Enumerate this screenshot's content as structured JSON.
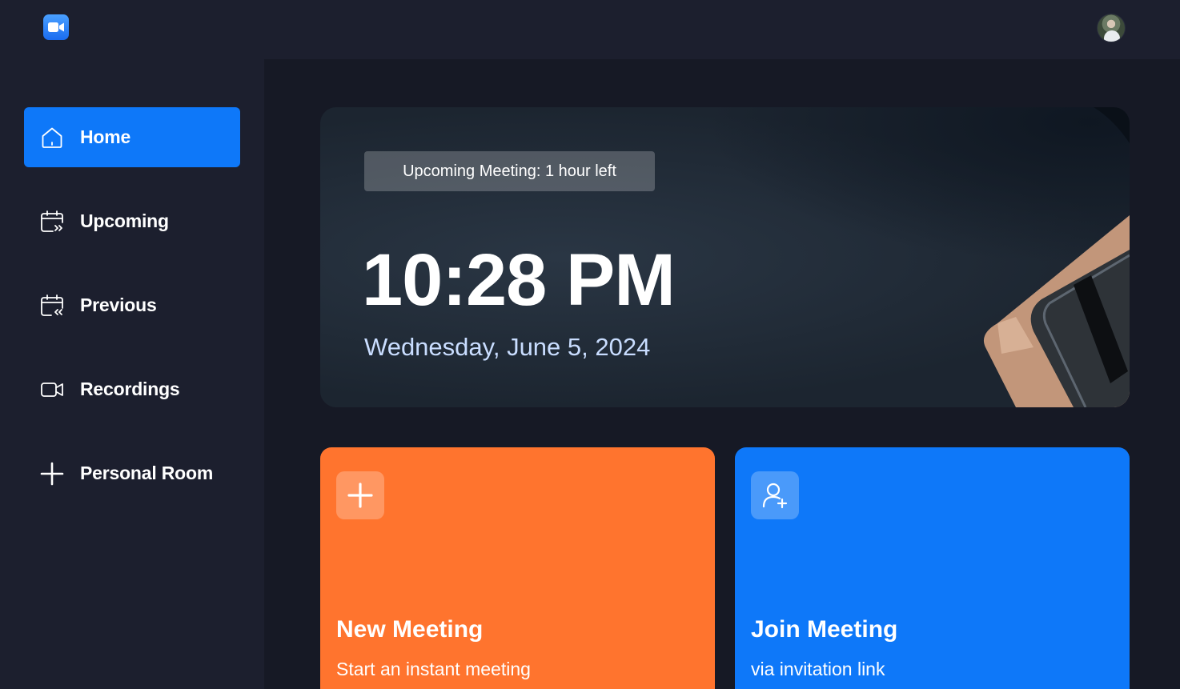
{
  "navbar": {
    "logo_icon": "video-camera-icon",
    "avatar_icon": "user-avatar"
  },
  "sidebar": {
    "items": [
      {
        "label": "Home",
        "icon": "home-icon",
        "active": true
      },
      {
        "label": "Upcoming",
        "icon": "calendar-forward-icon",
        "active": false
      },
      {
        "label": "Previous",
        "icon": "calendar-back-icon",
        "active": false
      },
      {
        "label": "Recordings",
        "icon": "video-icon",
        "active": false
      },
      {
        "label": "Personal Room",
        "icon": "plus-icon",
        "active": false
      }
    ]
  },
  "hero": {
    "badge": "Upcoming Meeting: 1 hour left",
    "time": "10:28 PM",
    "date": "Wednesday, June 5, 2024"
  },
  "cards": [
    {
      "title": "New Meeting",
      "subtitle": "Start an instant meeting",
      "icon": "plus-icon",
      "color": "#ff742e"
    },
    {
      "title": "Join Meeting",
      "subtitle": "via invitation link",
      "icon": "add-user-icon",
      "color": "#0e78f9"
    }
  ],
  "colors": {
    "accent": "#0e78f9",
    "sidebar_bg": "#1c1f2e",
    "page_bg": "#161925",
    "orange": "#ff742e"
  }
}
